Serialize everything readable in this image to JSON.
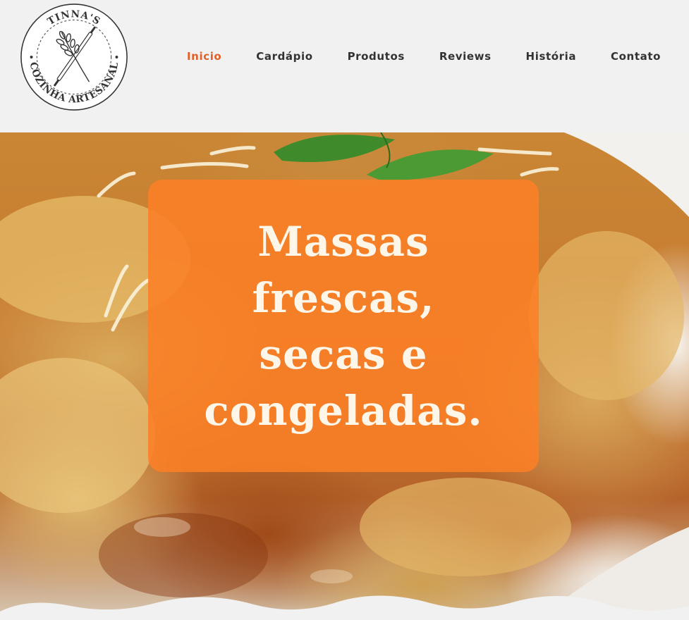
{
  "brand": {
    "logo_text_top": "TINNA'S",
    "logo_text_bottom": "COZINHA ARTESANAL",
    "logo_icon": "wheat-and-rolling-pin-icon"
  },
  "nav": {
    "items": [
      {
        "label": "Inicio",
        "active": true
      },
      {
        "label": "Cardápio",
        "active": false
      },
      {
        "label": "Produtos",
        "active": false
      },
      {
        "label": "Reviews",
        "active": false
      },
      {
        "label": "História",
        "active": false
      },
      {
        "label": "Contato",
        "active": false
      }
    ]
  },
  "hero": {
    "headline_lines": [
      "Massas",
      "frescas,",
      "secas e",
      "congeladas."
    ],
    "background_image": "ravioli-with-tomato-sauce-and-basil"
  },
  "colors": {
    "accent": "#e0602a",
    "nav_text": "#333333",
    "header_bg": "#f1f1f1",
    "headline_box": "#fc8026",
    "headline_text": "#fff6ea"
  }
}
